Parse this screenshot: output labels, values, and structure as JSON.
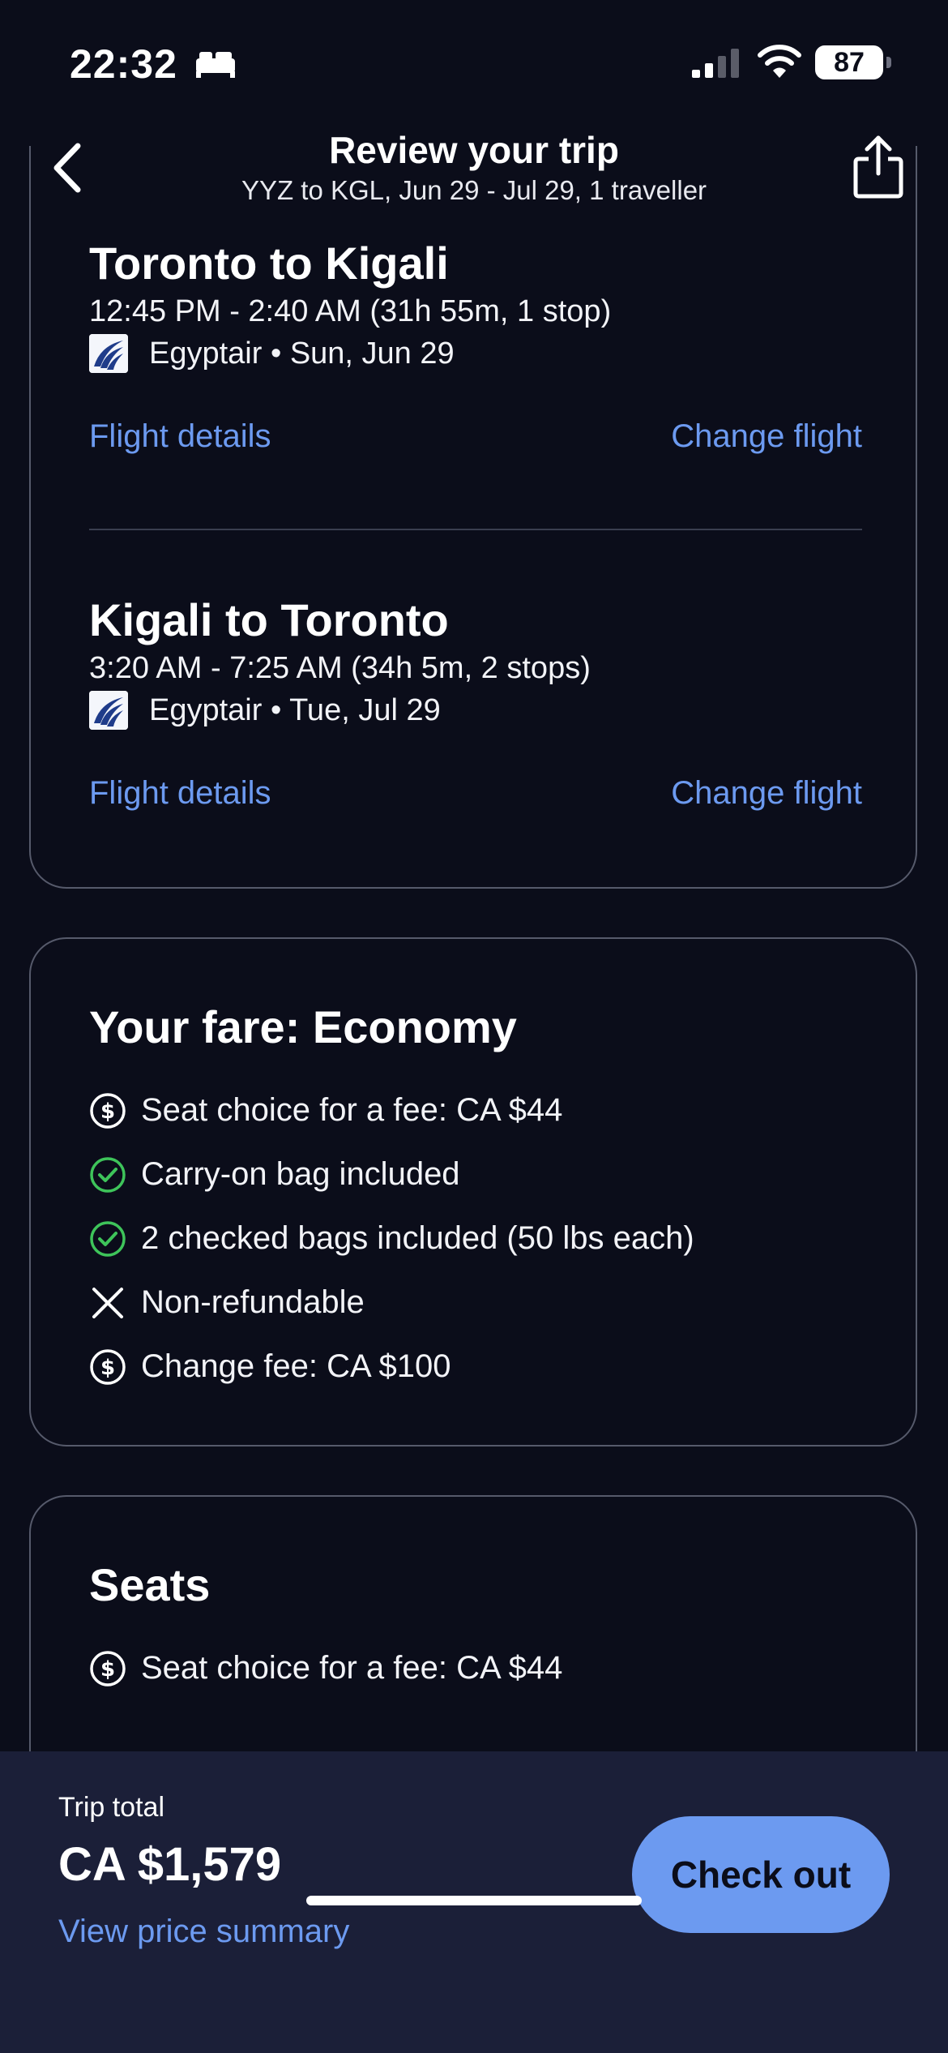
{
  "status_bar": {
    "time": "22:32",
    "battery": "87"
  },
  "header": {
    "title": "Review your trip",
    "subtitle": "YYZ to KGL, Jun 29 - Jul 29, 1 traveller"
  },
  "flights": [
    {
      "title": "Toronto to Kigali",
      "times": "12:45 PM - 2:40 AM (31h 55m, 1 stop)",
      "airline_date": "Egyptair • Sun, Jun 29",
      "details_link": "Flight details",
      "change_link": "Change flight"
    },
    {
      "title": "Kigali to Toronto",
      "times": "3:20 AM - 7:25 AM (34h 5m, 2 stops)",
      "airline_date": "Egyptair • Tue, Jul 29",
      "details_link": "Flight details",
      "change_link": "Change flight"
    }
  ],
  "fare": {
    "title": "Your fare: Economy",
    "features": [
      {
        "icon": "dollar-icon",
        "text": "Seat choice for a fee: CA $44"
      },
      {
        "icon": "check-icon",
        "text": "Carry-on bag included"
      },
      {
        "icon": "check-icon",
        "text": "2 checked bags included (50 lbs each)"
      },
      {
        "icon": "x-icon",
        "text": "Non-refundable"
      },
      {
        "icon": "dollar-icon",
        "text": "Change fee: CA $100"
      }
    ]
  },
  "seats": {
    "title": "Seats",
    "features": [
      {
        "icon": "dollar-icon",
        "text": "Seat choice for a fee: CA $44"
      }
    ]
  },
  "footer": {
    "total_label": "Trip total",
    "total_price": "CA $1,579",
    "summary_link": "View price summary",
    "checkout_label": "Check out"
  },
  "colors": {
    "background": "#0b0d1a",
    "footer": "#1b1f38",
    "accent": "#6c9af0",
    "check": "#3ec45a"
  }
}
